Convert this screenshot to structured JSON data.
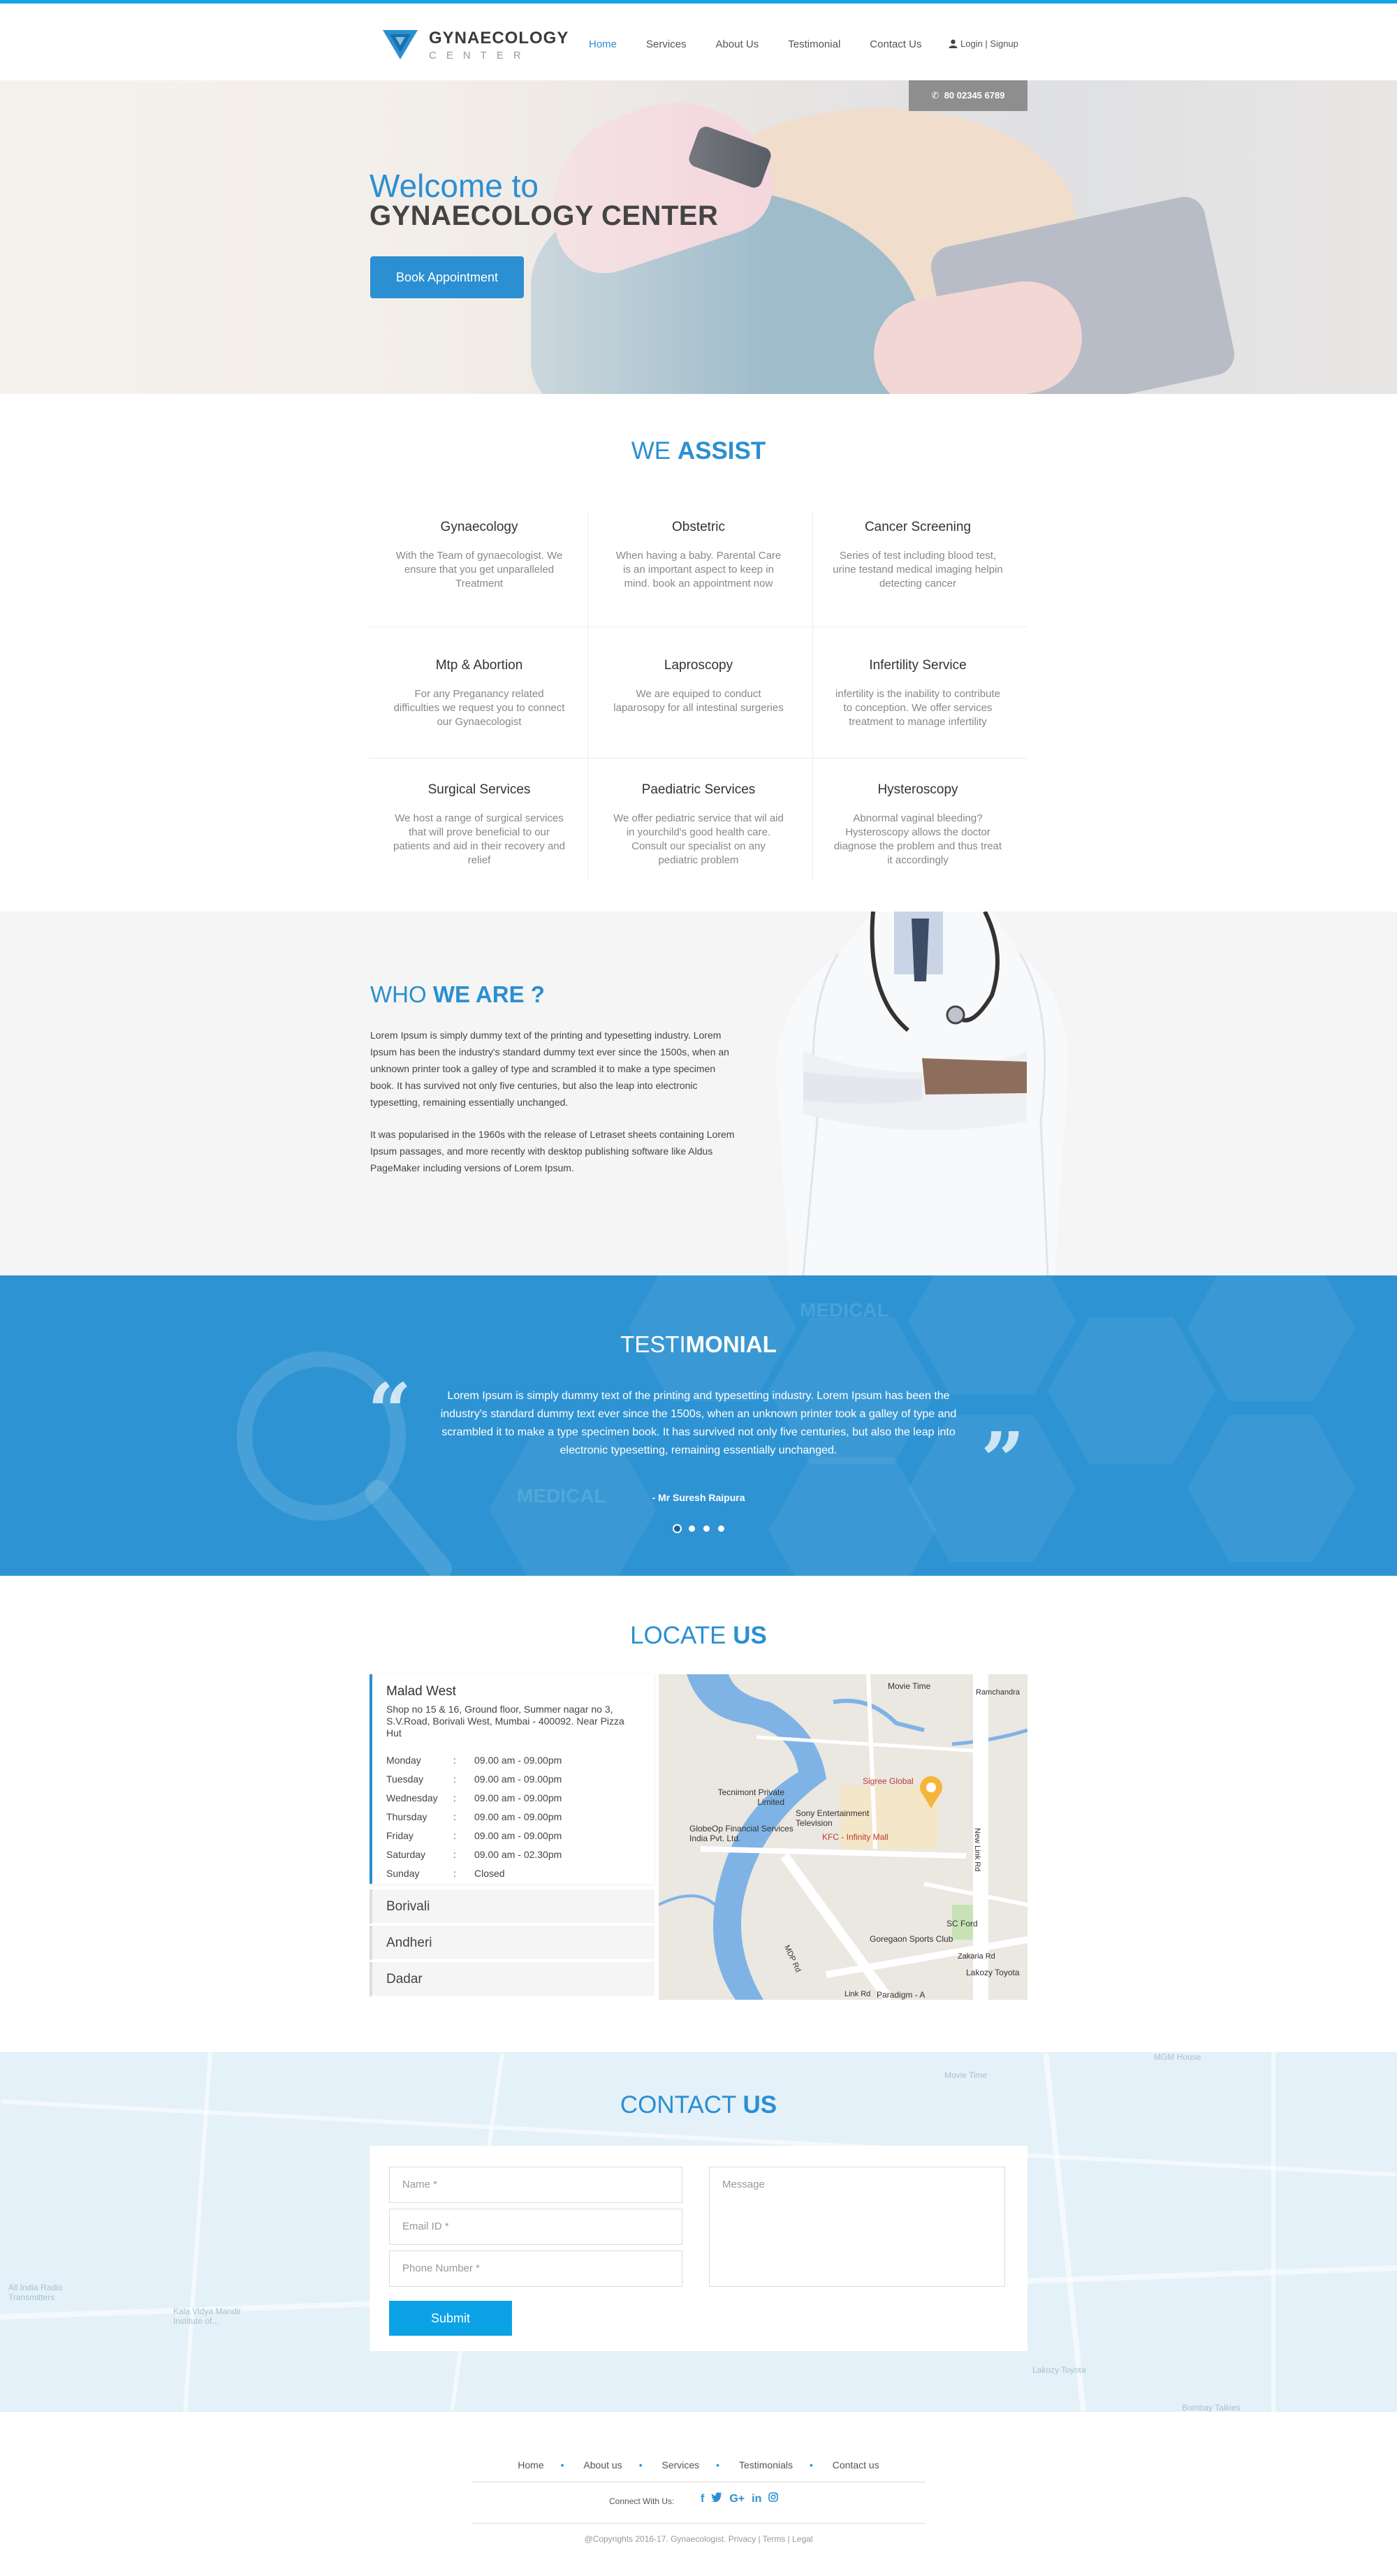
{
  "header": {
    "logo_title": "GYNAECOLOGY",
    "logo_sub": "CENTER",
    "nav": [
      "Home",
      "Services",
      "About Us",
      "Testimonial",
      "Contact Us"
    ],
    "login": "Login | Signup"
  },
  "hero": {
    "phone": "80 02345 6789",
    "title_line1": "Welcome to",
    "title_line2": "GYNAECOLOGY CENTER",
    "cta": "Book Appointment"
  },
  "assist": {
    "title_a": "WE ",
    "title_b": "ASSIST",
    "services": [
      {
        "name": "Gynaecology",
        "desc": "With the Team of gynaecologist. We ensure that you get unparalleled Treatment"
      },
      {
        "name": "Obstetric",
        "desc": "When having a baby. Parental Care is an important aspect to keep in mind. book an appointment now"
      },
      {
        "name": "Cancer Screening",
        "desc": "Series of test including blood test, urine testand medical imaging helpin detecting cancer"
      },
      {
        "name": "Mtp & Abortion",
        "desc": "For any Preganancy related difficulties we request you to connect our Gynaecologist"
      },
      {
        "name": "Laproscopy",
        "desc": "We are equiped to conduct laparosopy for all intestinal surgeries"
      },
      {
        "name": "Infertility Service",
        "desc": "infertility is the inability to contribute to conception. We offer services treatment to manage infertility"
      },
      {
        "name": "Surgical Services",
        "desc": "We host a range of surgical services that will prove beneficial to our patients and aid in their recovery and relief"
      },
      {
        "name": "Paediatric Services",
        "desc": "We offer pediatric service that wil aid in yourchild's good health care. Consult our specialist on any pediatric problem"
      },
      {
        "name": "Hysteroscopy",
        "desc": "Abnormal vaginal bleeding? Hysteroscopy allows the doctor diagnose the problem and thus treat it accordingly"
      }
    ]
  },
  "who": {
    "title_a": "WHO ",
    "title_b": "WE ARE ?",
    "para1": "Lorem Ipsum is simply dummy text of the printing and typesetting industry. Lorem Ipsum has been the industry's standard dummy text ever since the 1500s, when an unknown printer took a galley of type and scrambled it to make a type specimen book. It has survived not only five centuries, but also the leap into electronic typesetting, remaining essentially unchanged.",
    "para2": "It was popularised in the 1960s with the release of Letraset sheets containing Lorem Ipsum passages, and more recently with desktop publishing software like Aldus PageMaker including versions of Lorem Ipsum."
  },
  "testimonial": {
    "title_a": "TESTI",
    "title_b": "MONIAL",
    "quote": "Lorem Ipsum is simply dummy text of the printing and typesetting industry. Lorem Ipsum has been the industry's standard dummy text ever since the 1500s, when an unknown printer took a galley of type and scrambled it to make a type specimen book. It has survived not only five centuries, but also the leap into electronic typesetting, remaining essentially unchanged.",
    "author": "- Mr Suresh Raipura",
    "bg_words": [
      "MEDICAL",
      "MEDICAL"
    ]
  },
  "locate": {
    "title_a": "LOCATE ",
    "title_b": "US",
    "active": {
      "name": "Malad West",
      "address": "Shop no 15 & 16, Ground floor, Summer nagar no 3, S.V.Road, Borivali West, Mumbai - 400092. Near Pizza Hut",
      "hours": [
        {
          "day": "Monday",
          "time": "09.00 am - 09.00pm"
        },
        {
          "day": "Tuesday",
          "time": "09.00 am - 09.00pm"
        },
        {
          "day": "Wednesday",
          "time": "09.00 am - 09.00pm"
        },
        {
          "day": "Thursday",
          "time": "09.00 am - 09.00pm"
        },
        {
          "day": "Friday",
          "time": "09.00 am - 09.00pm"
        },
        {
          "day": "Saturday",
          "time": "09.00 am - 02.30pm"
        },
        {
          "day": "Sunday",
          "time": "Closed"
        }
      ]
    },
    "others": [
      "Borivali",
      "Andheri",
      "Dadar"
    ],
    "map_labels": [
      "Movie Time",
      "Ramchandra",
      "Sigree Global",
      "Tecnimont Private Limited",
      "Sony Entertainment Television",
      "GlobeOp Financial Services India Pvt. Ltd.",
      "KFC - Infinity Mall",
      "SC Ford",
      "Goregaon Sports Club",
      "Zakaria Rd",
      "Lakozy Toyota",
      "Paradigm - A",
      "New Link Rd",
      "MDP Rd",
      "Link Rd"
    ]
  },
  "contact": {
    "title_a": "CONTACT ",
    "title_b": "US",
    "name_ph": "Name *",
    "email_ph": "Email ID *",
    "phone_ph": "Phone Number *",
    "message_ph": "Message",
    "submit": "Submit",
    "map_labels": [
      "MGM House",
      "Movie Time",
      "All India Radio Transmitters",
      "Kala Vidya Mandir Institute of...",
      "Lakozy Toyota",
      "Bombay Talkies"
    ]
  },
  "footer": {
    "nav": [
      "Home",
      "About us",
      "Services",
      "Testimonials",
      "Contact us"
    ],
    "connect": "Connect With Us:",
    "social": [
      "f",
      "t",
      "G+",
      "in",
      "ig"
    ],
    "copyright": "@Copyrights 2016-17. Gynaecologist. Privacy | Terms | Legal"
  }
}
